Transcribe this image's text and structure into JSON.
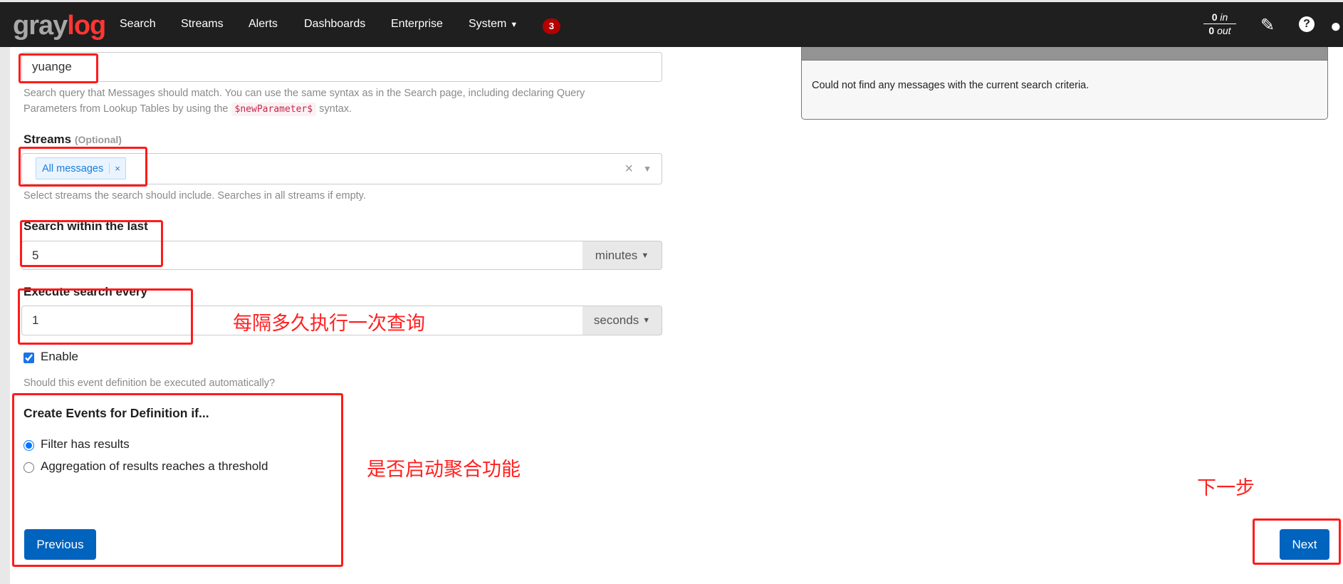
{
  "navbar": {
    "logo": "graylog",
    "items": [
      "Search",
      "Streams",
      "Alerts",
      "Dashboards",
      "Enterprise",
      "System"
    ],
    "notification_count": "3",
    "throughput": {
      "in_value": "0",
      "in_label": "in",
      "out_value": "0",
      "out_label": "out"
    },
    "icons": [
      "edit-icon",
      "help-icon",
      "user-icon"
    ]
  },
  "form": {
    "query_value": "yuange",
    "query_help_1": "Search query that Messages should match. You can use the same syntax as in the Search page, including declaring Query",
    "query_help_2a": "Parameters from Lookup Tables by using the",
    "query_help_code": "$newParameter$",
    "query_help_2b": "syntax.",
    "streams_label": "Streams",
    "streams_optional": "(Optional)",
    "streams_tag": "All messages",
    "streams_tag_remove": "×",
    "streams_help": "Select streams the search should include. Searches in all streams if empty.",
    "search_within_label": "Search within the last",
    "search_within_value": "5",
    "search_within_unit": "minutes",
    "execute_label": "Execute search every",
    "execute_value": "1",
    "execute_unit": "seconds",
    "enable_label": "Enable",
    "enable_checked": true,
    "enable_help": "Should this event definition be executed automatically?",
    "create_heading": "Create Events for Definition if...",
    "radio_options": [
      {
        "label": "Filter has results",
        "checked": true
      },
      {
        "label": "Aggregation of results reaches a threshold",
        "checked": false
      }
    ],
    "previous_label": "Previous",
    "next_label": "Next"
  },
  "preview": {
    "message": "Could not find any messages with the current search criteria."
  },
  "annotations": {
    "execute_note": "每隔多久执行一次查询",
    "aggregation_note": "是否启动聚合功能",
    "next_note": "下一步"
  },
  "colors": {
    "navbar": "#1f1f1f",
    "primary": "#0063be",
    "annotation": "#ff1a1a",
    "badge": "#b40000"
  }
}
